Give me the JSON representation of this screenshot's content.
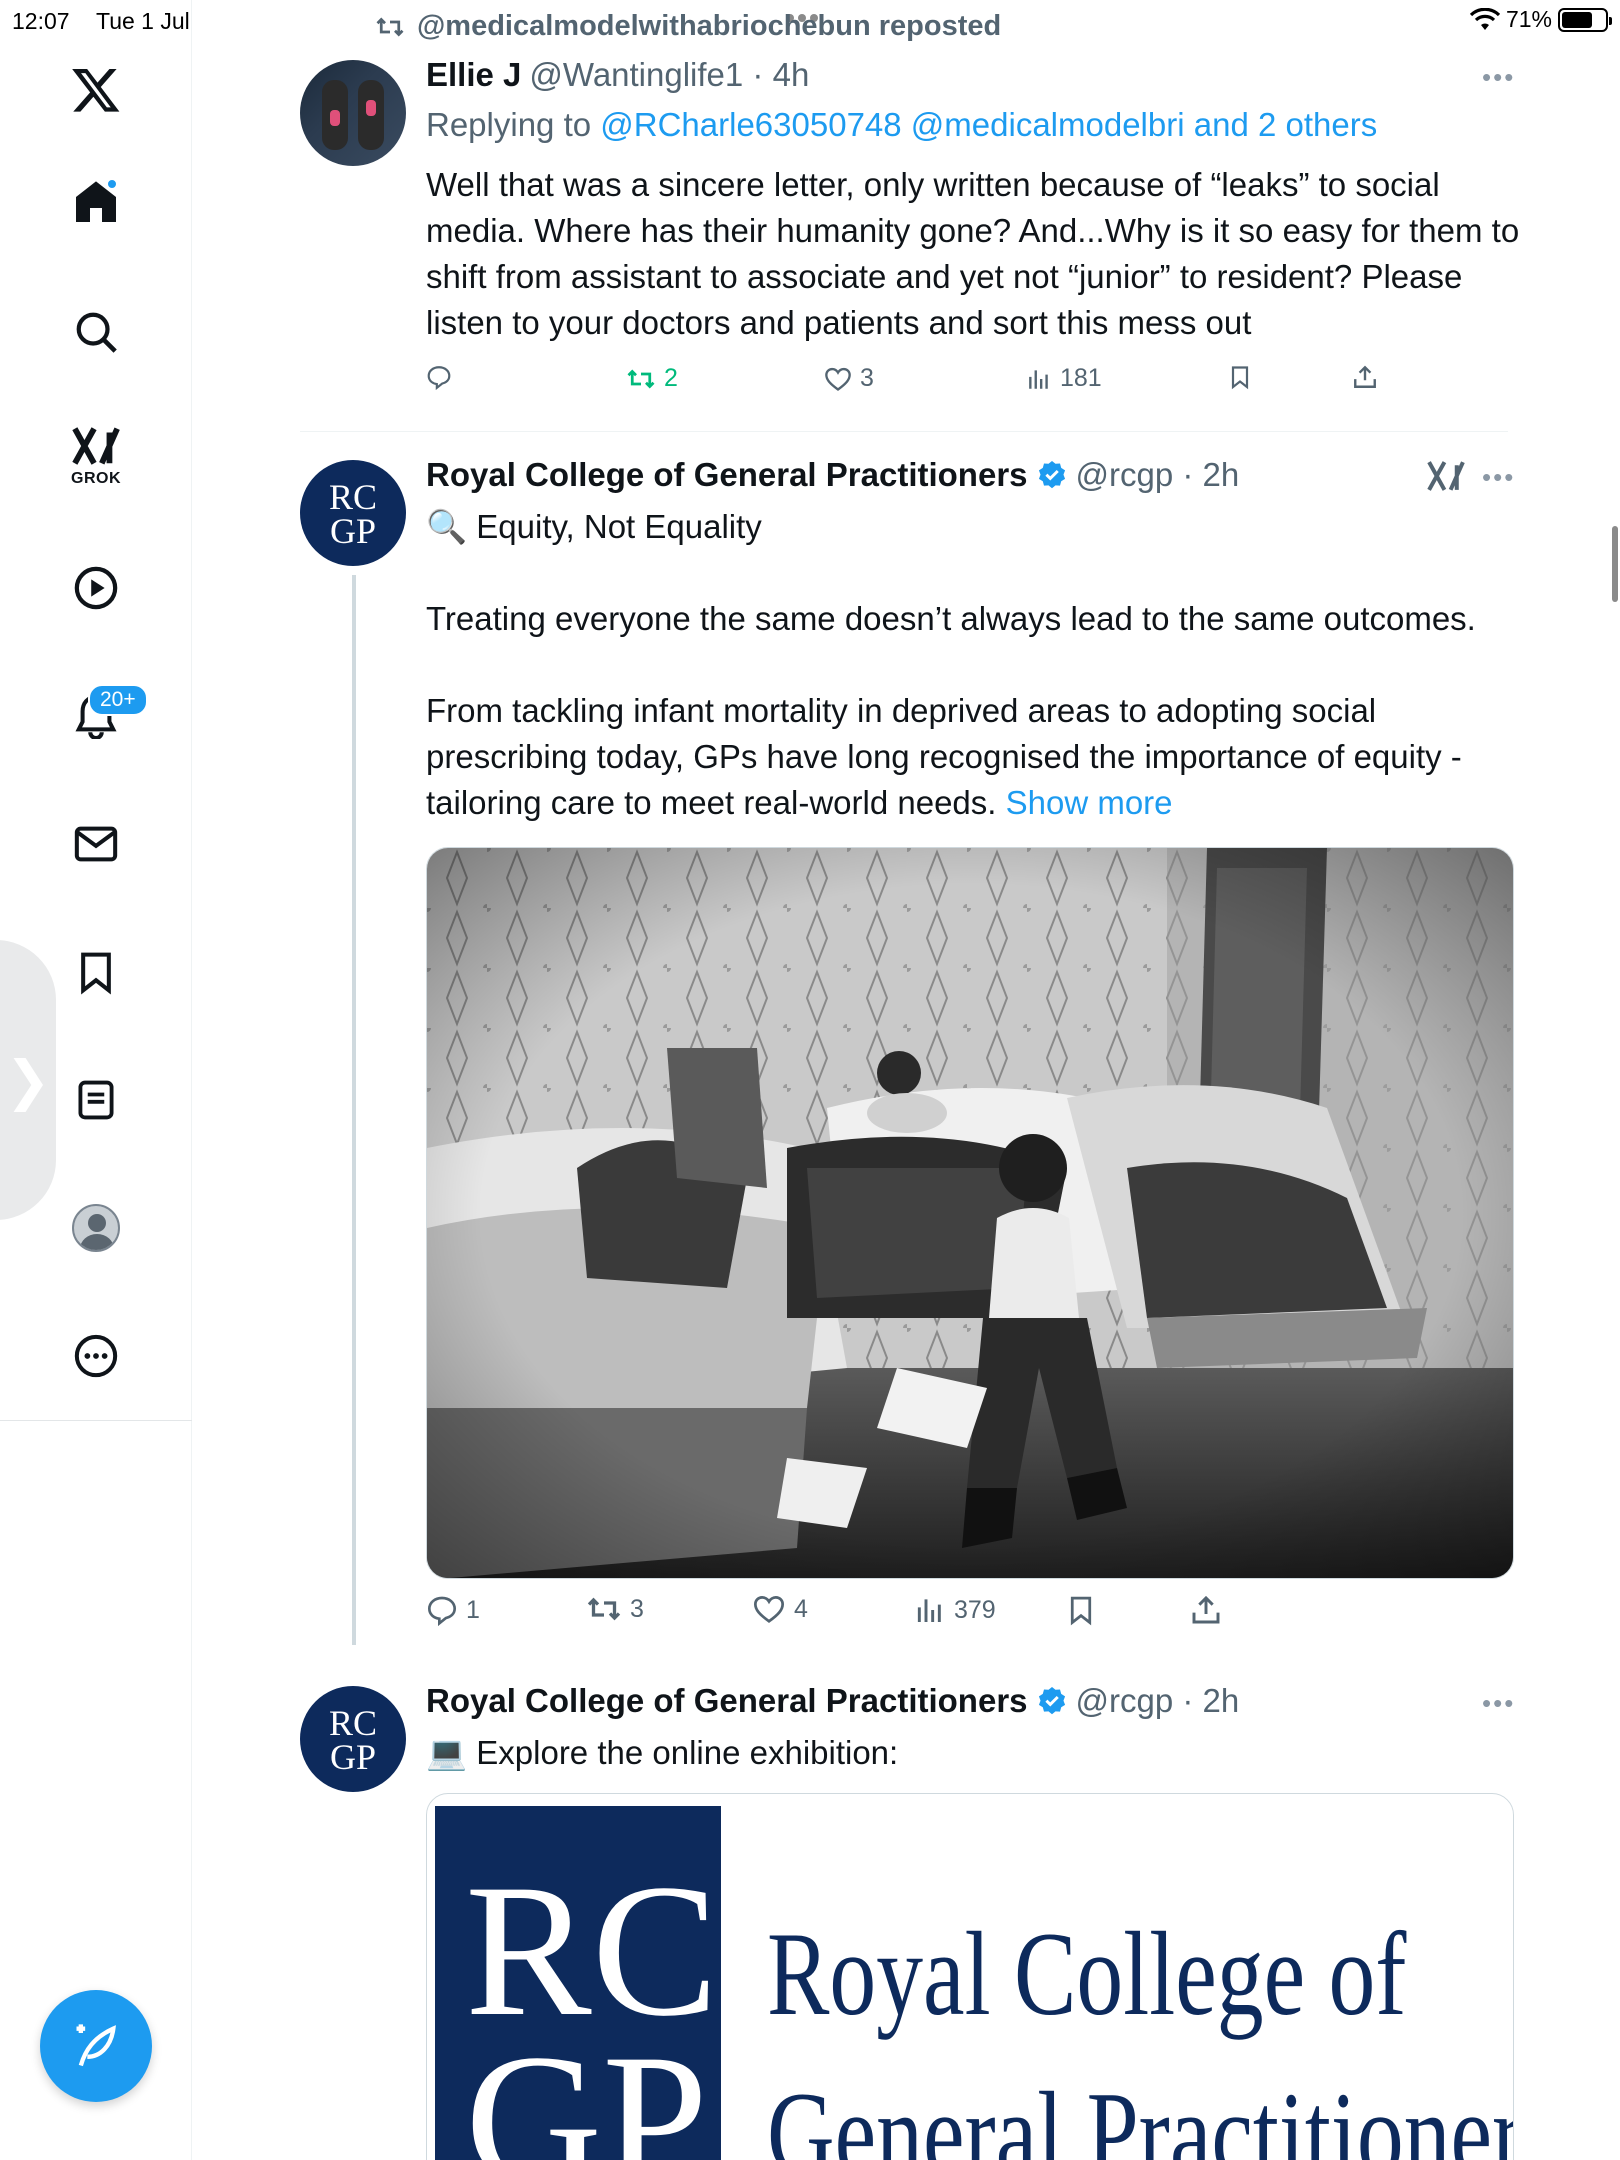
{
  "status_bar": {
    "time": "12:07",
    "date": "Tue 1 Jul",
    "battery_percent": "71%",
    "battery_level": 0.71
  },
  "sidebar": {
    "items": [
      {
        "icon": "x-logo-icon"
      },
      {
        "icon": "home-icon"
      },
      {
        "icon": "search-icon"
      },
      {
        "icon": "grok-icon",
        "label": "GROK"
      },
      {
        "icon": "video-play-icon"
      },
      {
        "icon": "notifications-bell-icon",
        "badge": "20+"
      },
      {
        "icon": "messages-envelope-icon"
      },
      {
        "icon": "bookmarks-icon"
      },
      {
        "icon": "lists-icon"
      },
      {
        "icon": "profile-avatar-icon"
      },
      {
        "icon": "more-circle-icon"
      }
    ],
    "compose_icon": "compose-feather-icon",
    "accent_color": "#1d9bf0"
  },
  "feed": {
    "repost_banner": "@medicalmodelwithabriochebun reposted",
    "tweets": [
      {
        "name": "Ellie J",
        "handle": "@Wantinglife1 · 4h",
        "replying_prefix": "Replying to ",
        "replying_to": "@RCharle63050748 @medicalmodelbri and 2 others",
        "text": "Well that was a sincere letter, only written because of “leaks” to social media. Where has their humanity gone? And...Why is it so easy for them to shift from assistant to associate and yet not “junior” to resident? Please listen to your doctors and patients and sort this mess out",
        "replies": "",
        "reposts": "2",
        "likes": "3",
        "views": "181"
      },
      {
        "name": "Royal College of General Practitioners",
        "handle": "@rcgp · 2h",
        "avatar_text_1": "RC",
        "avatar_text_2": "GP",
        "line1_emoji": "🔍",
        "line1": "Equity, Not Equality",
        "para2": "Treating everyone the same doesn’t always lead to the same outcomes.",
        "para3": "From tackling infant mortality in deprived areas to adopting social prescribing today, GPs have long recognised the importance of equity - tailoring care to meet real-world needs.",
        "show_more": "Show more",
        "replies": "1",
        "reposts": "3",
        "likes": "4",
        "views": "379"
      },
      {
        "name": "Royal College of General Practitioners",
        "handle": "@rcgp · 2h",
        "avatar_text_1": "RC",
        "avatar_text_2": "GP",
        "line1_emoji": "💻",
        "line1": "Explore the online exhibition:",
        "card_logo_1": "RC",
        "card_logo_2": "GP",
        "card_title_1": "Royal College of",
        "card_title_2": "General Practitioners"
      }
    ]
  }
}
